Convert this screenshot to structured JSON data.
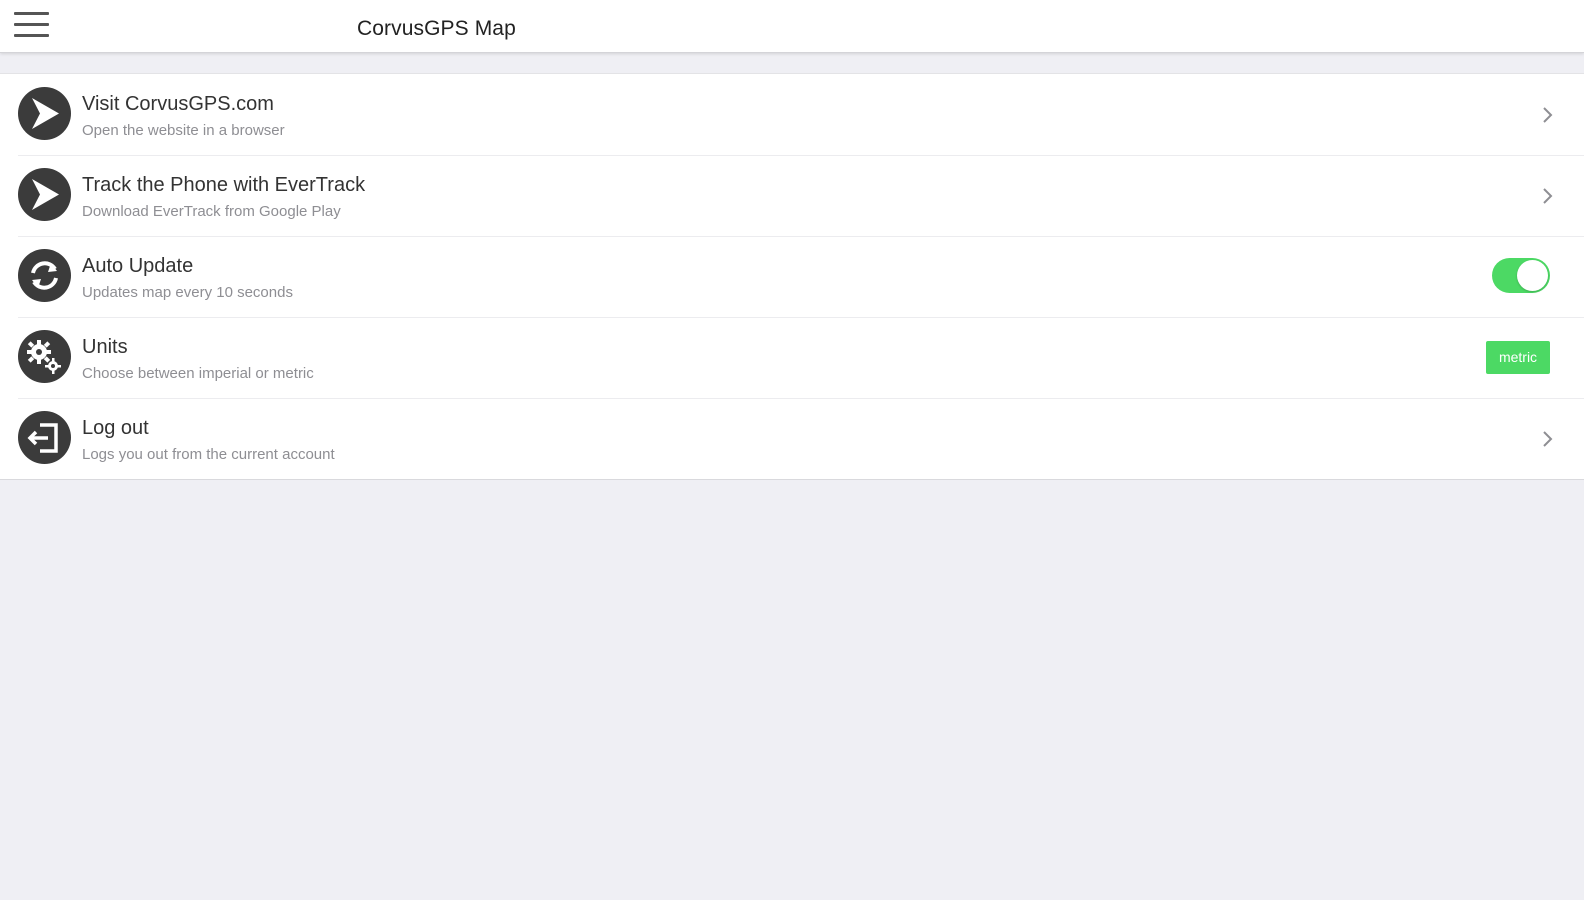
{
  "header": {
    "title": "CorvusGPS Map",
    "menu_icon": "hamburger-menu-icon"
  },
  "colors": {
    "accent": "#4cd964",
    "icon_bg": "#3b3b3b",
    "background": "#efeff4"
  },
  "settings": {
    "items": [
      {
        "title": "Visit CorvusGPS.com",
        "subtitle": "Open the website in a browser",
        "icon": "arrow-navigation-icon",
        "control": "chevron"
      },
      {
        "title": "Track the Phone with EverTrack",
        "subtitle": "Download EverTrack from Google Play",
        "icon": "arrow-navigation-icon",
        "control": "chevron"
      },
      {
        "title": "Auto Update",
        "subtitle": "Updates map every 10 seconds",
        "icon": "refresh-icon",
        "control": "toggle",
        "toggle_on": true
      },
      {
        "title": "Units",
        "subtitle": "Choose between imperial or metric",
        "icon": "gears-icon",
        "control": "badge",
        "value": "metric"
      },
      {
        "title": "Log out",
        "subtitle": "Logs you out from the current account",
        "icon": "logout-icon",
        "control": "chevron"
      }
    ]
  }
}
